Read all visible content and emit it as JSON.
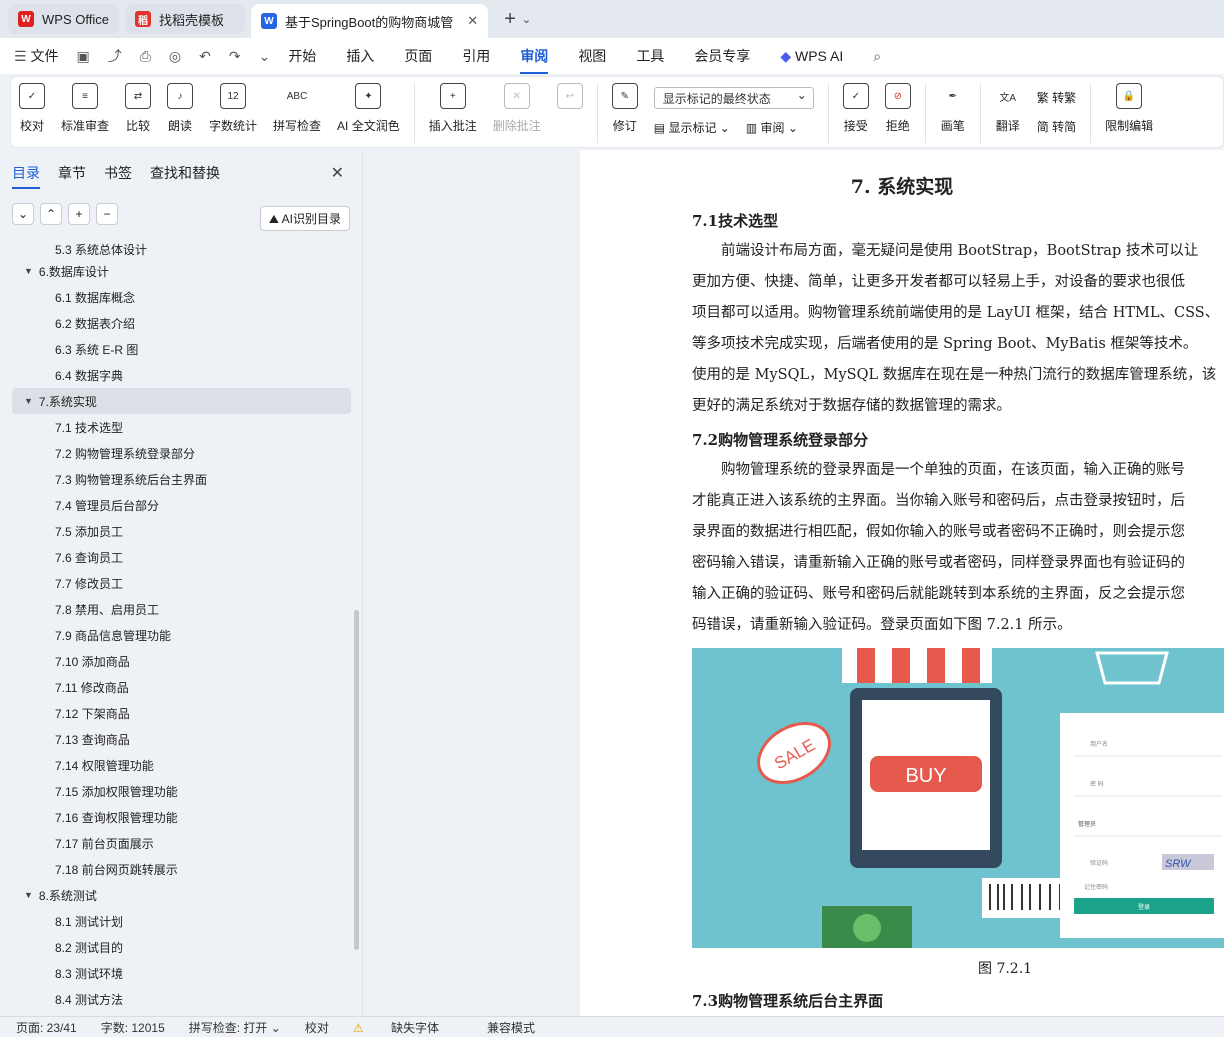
{
  "tabs": [
    {
      "label": "WPS Office"
    },
    {
      "label": "找稻壳模板"
    },
    {
      "label": "基于SpringBoot的购物商城管"
    }
  ],
  "menu": {
    "file": "文件",
    "items": [
      "开始",
      "插入",
      "页面",
      "引用",
      "审阅",
      "视图",
      "工具",
      "会员专享"
    ],
    "active": "审阅",
    "wpsai": "WPS AI"
  },
  "ribbon": {
    "proofread": "校对",
    "standard_review": "标准审查",
    "compare": "比较",
    "read_aloud": "朗读",
    "word_count": "字数统计",
    "spell_check": "拼写检查",
    "ai_polish": "AI 全文润色",
    "insert_comment": "插入批注",
    "delete_comment": "删除批注",
    "revise": "修订",
    "show_mode": "显示标记的最终状态",
    "show_marks": "显示标记",
    "review": "审阅",
    "accept": "接受",
    "reject": "拒绝",
    "pen": "画笔",
    "translate": "翻译",
    "to_trad": "转繁",
    "to_simp": "转简",
    "restrict_edit": "限制编辑"
  },
  "sidebar": {
    "tabs": [
      "目录",
      "章节",
      "书签",
      "查找和替换"
    ],
    "ai_toc": "AI识别目录",
    "toc": [
      {
        "t": "5.3 系统总体设计",
        "lvl": 2
      },
      {
        "t": "6.数据库设计",
        "lvl": 1
      },
      {
        "t": "6.1 数据库概念",
        "lvl": 2
      },
      {
        "t": "6.2 数据表介绍",
        "lvl": 2
      },
      {
        "t": "6.3 系统 E-R 图",
        "lvl": 2
      },
      {
        "t": "6.4 数据字典",
        "lvl": 2
      },
      {
        "t": "7.系统实现",
        "lvl": 1,
        "sel": true
      },
      {
        "t": "7.1 技术选型",
        "lvl": 2
      },
      {
        "t": "7.2 购物管理系统登录部分",
        "lvl": 2
      },
      {
        "t": "7.3 购物管理系统后台主界面",
        "lvl": 2
      },
      {
        "t": "7.4 管理员后台部分",
        "lvl": 2
      },
      {
        "t": "7.5 添加员工",
        "lvl": 2
      },
      {
        "t": "7.6 查询员工",
        "lvl": 2
      },
      {
        "t": "7.7 修改员工",
        "lvl": 2
      },
      {
        "t": "7.8 禁用、启用员工",
        "lvl": 2
      },
      {
        "t": "7.9 商品信息管理功能",
        "lvl": 2
      },
      {
        "t": "7.10 添加商品",
        "lvl": 2
      },
      {
        "t": "7.11 修改商品",
        "lvl": 2
      },
      {
        "t": "7.12 下架商品",
        "lvl": 2
      },
      {
        "t": "7.13 查询商品",
        "lvl": 2
      },
      {
        "t": "7.14 权限管理功能",
        "lvl": 2
      },
      {
        "t": "7.15 添加权限管理功能",
        "lvl": 2
      },
      {
        "t": "7.16 查询权限管理功能",
        "lvl": 2
      },
      {
        "t": "7.17 前台页面展示",
        "lvl": 2
      },
      {
        "t": "7.18 前台网页跳转展示",
        "lvl": 2
      },
      {
        "t": "8.系统测试",
        "lvl": 1
      },
      {
        "t": "8.1 测试计划",
        "lvl": 2
      },
      {
        "t": "8.2 测试目的",
        "lvl": 2
      },
      {
        "t": "8.3 测试环境",
        "lvl": 2
      },
      {
        "t": "8.4 测试方法",
        "lvl": 2
      }
    ]
  },
  "doc": {
    "h1": "7. 系统实现",
    "h2a": "7.1技术选型",
    "h2b": "7.2购物管理系统登录部分",
    "h2c": "7.3购物管理系统后台主界面",
    "pa": [
      "　　前端设计布局方面，毫无疑问是使用 BootStrap，BootStrap 技术可以让",
      "更加方便、快捷、简单，让更多开发者都可以轻易上手，对设备的要求也很低",
      "项目都可以适用。购物管理系统前端使用的是 LayUI 框架，结合 HTML、CSS、",
      "等多项技术完成实现，后端者使用的是 Spring Boot、MyBatis 框架等技术。",
      "使用的是 MySQL，MySQL 数据库在现在是一种热门流行的数据库管理系统，该",
      "更好的满足系统对于数据存储的数据管理的需求。"
    ],
    "pb": [
      "　　购物管理系统的登录界面是一个单独的页面，在该页面，输入正确的账号",
      "才能真正进入该系统的主界面。当你输入账号和密码后，点击登录按钮时，后",
      "录界面的数据进行相匹配，假如你输入的账号或者密码不正确时，则会提示您",
      "密码输入错误，请重新输入正确的账号或者密码，同样登录界面也有验证码的",
      "输入正确的验证码、账号和密码后就能跳转到本系统的主界面，反之会提示您",
      "码错误，请重新输入验证码。登录页面如下图 7.2.1 所示。"
    ],
    "img": {
      "sale": "SALE",
      "buy": "BUY",
      "user": "用户名",
      "pwd": "密 码",
      "role": "管理员",
      "captcha": "验证码",
      "code": "SRW",
      "remember": "记住密码",
      "login": "登录"
    },
    "caption": "图 7.2.1"
  },
  "status": {
    "page": "页面: 23/41",
    "words": "字数: 12015",
    "spell": "拼写检查: 打开 ⌄",
    "proof": "校对",
    "font": "缺失字体",
    "compat": "兼容模式"
  }
}
